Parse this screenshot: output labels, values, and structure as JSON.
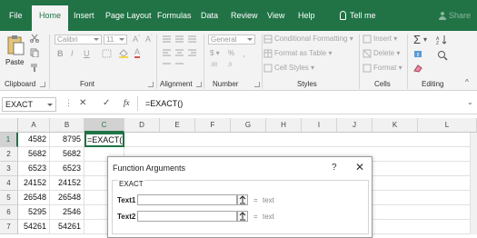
{
  "ribbon_tabs": [
    "File",
    "Home",
    "Insert",
    "Page Layout",
    "Formulas",
    "Data",
    "Review",
    "View",
    "Help"
  ],
  "active_tab": "Home",
  "tell_me": "Tell me",
  "share": "Share",
  "clipboard": {
    "paste": "Paste",
    "label": "Clipboard"
  },
  "font": {
    "name": "Calibri",
    "size": "11",
    "label": "Font"
  },
  "alignment": {
    "label": "Alignment"
  },
  "number": {
    "format": "General",
    "label": "Number"
  },
  "styles": {
    "conditional": "Conditional Formatting",
    "table": "Format as Table",
    "cell": "Cell Styles",
    "label": "Styles"
  },
  "cells": {
    "insert": "Insert",
    "delete": "Delete",
    "format": "Format",
    "label": "Cells"
  },
  "editing": {
    "label": "Editing"
  },
  "formula_bar": {
    "name_box": "EXACT",
    "cancel": "✕",
    "enter": "✓",
    "fx": "fx",
    "formula": "=EXACT()"
  },
  "columns": [
    "A",
    "B",
    "C",
    "D",
    "E",
    "F",
    "G",
    "H",
    "I",
    "J",
    "K",
    "L"
  ],
  "rows": [
    "1",
    "2",
    "3",
    "4",
    "5",
    "6",
    "7"
  ],
  "cells_data": [
    [
      "4582",
      "8795",
      "=EXACT()"
    ],
    [
      "5682",
      "5682",
      ""
    ],
    [
      "6523",
      "6523",
      ""
    ],
    [
      "24152",
      "24152",
      ""
    ],
    [
      "26548",
      "26548",
      ""
    ],
    [
      "5295",
      "2546",
      ""
    ],
    [
      "54261",
      "54261",
      ""
    ]
  ],
  "dialog": {
    "title": "Function Arguments",
    "help": "?",
    "close": "✕",
    "function_name": "EXACT",
    "args": [
      {
        "label": "Text1",
        "eq": "=",
        "value": "text"
      },
      {
        "label": "Text2",
        "eq": "=",
        "value": "text"
      }
    ]
  },
  "colors": {
    "excel_green": "#217346",
    "ribbon_bg": "#f3f3f3"
  }
}
